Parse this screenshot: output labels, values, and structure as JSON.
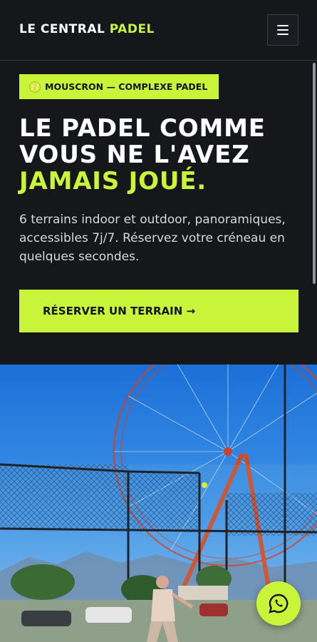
{
  "header": {
    "brand_main": "LE CENTRAL",
    "brand_accent": "PADEL",
    "menu_icon": "hamburger-menu-icon"
  },
  "hero": {
    "badge_icon": "padel-ball-icon",
    "badge_text": "MOUSCRON — COMPLEXE PADEL",
    "headline_line1": "LE PADEL COMME",
    "headline_line2": "VOUS NE L'AVEZ",
    "headline_accent": "JAMAIS JOUÉ.",
    "subtitle": "6 terrains indoor et outdoor, panoramiques, accessibles 7j/7. Réservez votre créneau en quelques secondes.",
    "cta_label": "RÉSERVER UN TERRAIN →"
  },
  "floating": {
    "whatsapp_icon": "whatsapp-icon"
  },
  "colors": {
    "background": "#16171b",
    "accent": "#c8f43a",
    "text": "#ffffff",
    "muted_text": "#d7d8dc"
  }
}
